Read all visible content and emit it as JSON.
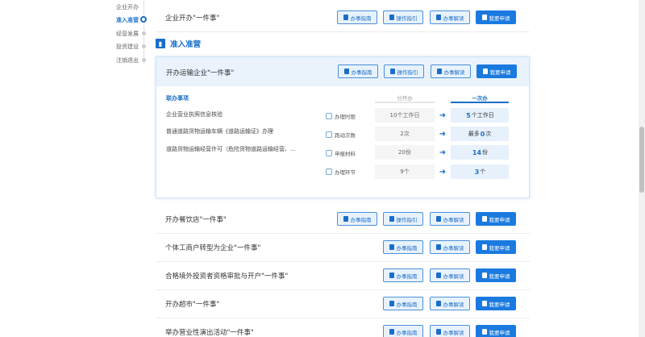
{
  "sidebar": {
    "items": [
      {
        "label": "企业开办"
      },
      {
        "label": "准入准营"
      },
      {
        "label": "经营发展"
      },
      {
        "label": "投资建设"
      },
      {
        "label": "注销退出"
      }
    ]
  },
  "buttons": {
    "guide": "办事指南",
    "instruction": "操作指引",
    "explain": "办事解读",
    "apply": "我要申请"
  },
  "section": {
    "icon_glyph": "▮",
    "title": "准入准营"
  },
  "top_row": {
    "title": "企业开办\"一件事\""
  },
  "card": {
    "title": "开办运输企业\"一件事\"",
    "matters_heading": "联办事项",
    "matters": [
      "企业营业执照信息核验",
      "普通道路货物运输车辆《道路运输证》办理",
      "道路货物运输经营许可（危险货物道路运输经营、..."
    ],
    "col_old": "分开办",
    "col_new": "一次办",
    "metrics": [
      {
        "label": "办理时限",
        "old": "10个工作日",
        "new_num": "5",
        "new_unit": "个工作日"
      },
      {
        "label": "跑动次数",
        "old": "2次",
        "new_prefix": "最多",
        "new_num": "0",
        "new_unit": "次"
      },
      {
        "label": "申报材料",
        "old": "20份",
        "new_num": "14",
        "new_unit": "份"
      },
      {
        "label": "办理环节",
        "old": "9个",
        "new_num": "3",
        "new_unit": "个"
      }
    ]
  },
  "rows": [
    {
      "title": "开办餐饮店\"一件事\""
    },
    {
      "title": "个体工商户转型为企业\"一件事\""
    },
    {
      "title": "合格境外投资者资格审批与开户\"一件事\""
    },
    {
      "title": "开办超市\"一件事\""
    },
    {
      "title": "举办营业性演出活动\"一件事\""
    }
  ],
  "colors": {
    "accent": "#1a6ec9",
    "primary_button": "#1a7ae0"
  }
}
